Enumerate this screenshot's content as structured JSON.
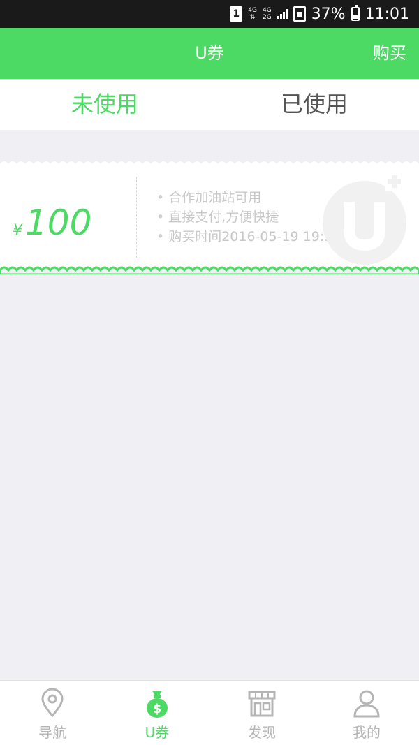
{
  "status_bar": {
    "sim_slot": "1",
    "net_top": "4G",
    "net_second_top": "4G",
    "net_second_bottom": "2G",
    "battery": "37%",
    "time": "11:01"
  },
  "header": {
    "title": "U券",
    "action": "购买"
  },
  "tabs": [
    {
      "label": "未使用",
      "active": true
    },
    {
      "label": "已使用",
      "active": false
    }
  ],
  "coupon": {
    "currency": "¥",
    "amount": "100",
    "details": [
      "合作加油站可用",
      "直接支付,方便快捷",
      "购买时间2016-05-19 19:57"
    ],
    "watermark_icon": "u-plus-logo-icon"
  },
  "bottom_nav": [
    {
      "label": "导航",
      "icon": "location-pin-icon",
      "active": false
    },
    {
      "label": "U券",
      "icon": "money-bag-icon",
      "active": true
    },
    {
      "label": "发现",
      "icon": "store-icon",
      "active": false
    },
    {
      "label": "我的",
      "icon": "user-icon",
      "active": false
    }
  ],
  "colors": {
    "accent": "#4cd964",
    "background": "#efeff4",
    "inactive": "#b5b5b5"
  }
}
